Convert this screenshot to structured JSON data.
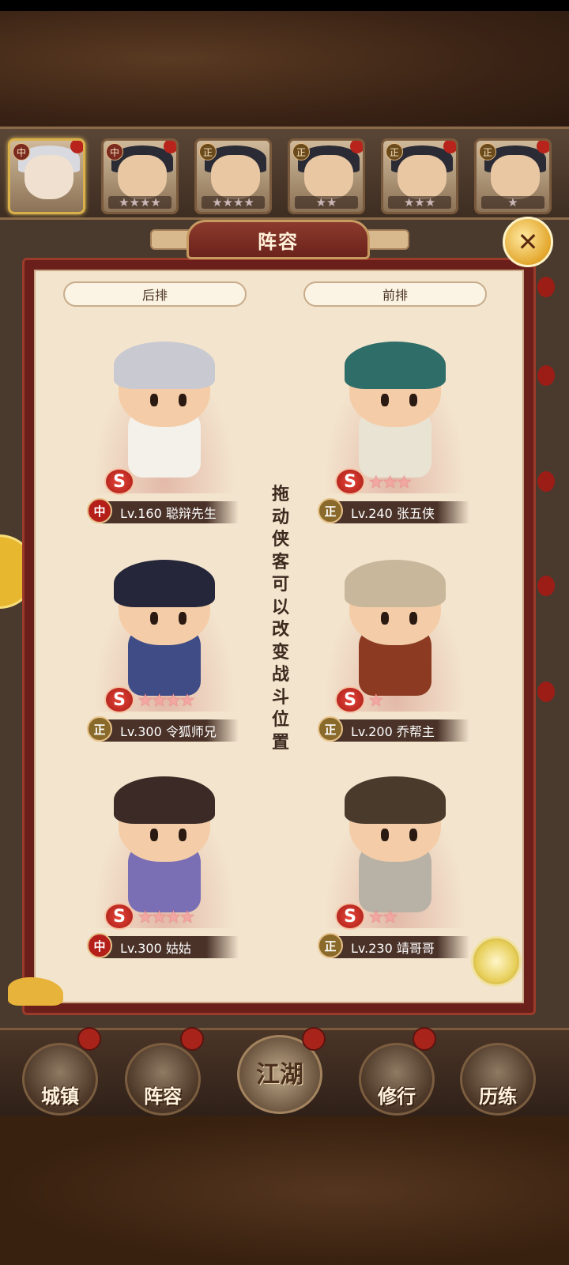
{
  "hero_strip": {
    "portraits": [
      {
        "badge": "中",
        "stars": "",
        "selected": true
      },
      {
        "badge": "中",
        "stars": "★★★★"
      },
      {
        "badge": "正",
        "stars": "★★★★"
      },
      {
        "badge": "正",
        "stars": "★★"
      },
      {
        "badge": "正",
        "stars": "★★★"
      },
      {
        "badge": "正",
        "stars": "★"
      }
    ]
  },
  "panel": {
    "title": "阵容",
    "close_icon": "✕",
    "back_row_label": "后排",
    "front_row_label": "前排",
    "hint": "拖动侠客可以改变战斗位置",
    "slots": [
      {
        "cls": "中",
        "level": "Lv.160 聪辩先生",
        "stars": "",
        "s_badge": "S"
      },
      {
        "cls": "正",
        "level": "Lv.240 张五侠",
        "stars": "★★★",
        "s_badge": "S"
      },
      {
        "cls": "正",
        "level": "Lv.300 令狐师兄",
        "stars": "★★★★",
        "s_badge": "S"
      },
      {
        "cls": "正",
        "level": "Lv.200 乔帮主",
        "stars": "★",
        "s_badge": "S"
      },
      {
        "cls": "中",
        "level": "Lv.300 姑姑",
        "stars": "★★★★",
        "s_badge": "S"
      },
      {
        "cls": "正",
        "level": "Lv.230 靖哥哥",
        "stars": "★★",
        "s_badge": "S"
      }
    ]
  },
  "nav": {
    "town": "城镇",
    "lineup": "阵容",
    "jianghu": "江湖",
    "cultivate": "修行",
    "training": "历练"
  },
  "colors": {
    "panel_red": "#6b1f1a",
    "paper": "#f3e4cd",
    "class_red": "#b51f1a",
    "class_gold": "#8a6a2a"
  }
}
